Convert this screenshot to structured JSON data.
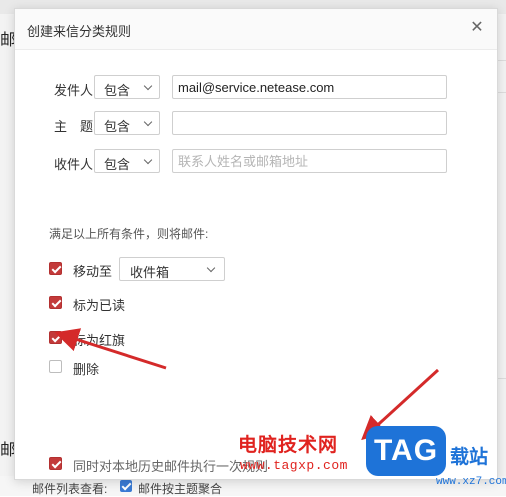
{
  "background": {
    "partial_text_1": "邮",
    "partial_text_2": "邮",
    "bottom_label": "邮件列表查看:",
    "bottom_option": "邮件按主题聚合"
  },
  "dialog": {
    "title": "创建来信分类规则",
    "close_icon": "close-icon",
    "conditions": [
      {
        "label": "发件人",
        "operator": "包含",
        "value": "mail@service.netease.com",
        "placeholder": ""
      },
      {
        "label": "主　题",
        "operator": "包含",
        "value": "",
        "placeholder": ""
      },
      {
        "label": "收件人",
        "operator": "包含",
        "value": "",
        "placeholder": "联系人姓名或邮箱地址"
      }
    ],
    "hint": "满足以上所有条件，则将邮件:",
    "actions": [
      {
        "label": "移动至",
        "checked": true,
        "target": "收件箱"
      },
      {
        "label": "标为已读",
        "checked": true
      },
      {
        "label": "标为红旗",
        "checked": true
      },
      {
        "label": "删除",
        "checked": false
      }
    ],
    "apply_history": {
      "label": "同时对本地历史邮件执行一次规则",
      "checked": true
    }
  },
  "watermark": {
    "cn_text": "电脑技术网",
    "url": "www.tagxp.com",
    "logo": "TAG",
    "site_char": "载站",
    "xz_url": "www.xz7.com"
  },
  "colors": {
    "checkbox_on": "#c33a3a",
    "arrow": "#d42a2a",
    "watermark_red": "#e0231f",
    "watermark_blue": "#1e73d8"
  }
}
